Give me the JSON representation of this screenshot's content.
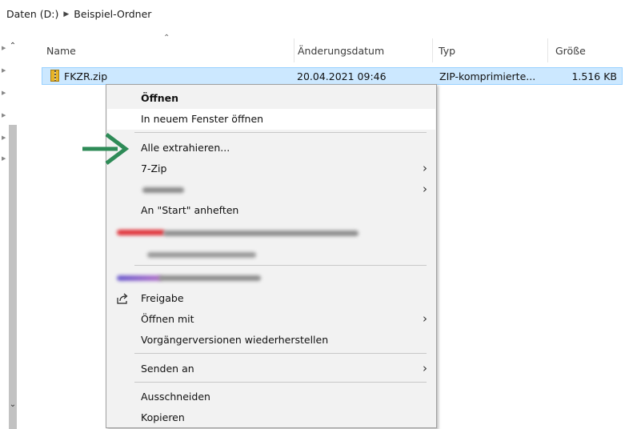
{
  "breadcrumb": {
    "items": [
      "Daten (D:)",
      "Beispiel-Ordner"
    ],
    "separator": "›"
  },
  "columns": {
    "name": "Name",
    "modified": "Änderungsdatum",
    "type": "Typ",
    "size": "Größe"
  },
  "file": {
    "name": "FKZR.zip",
    "modified": "20.04.2021 09:46",
    "type": "ZIP-komprimierte...",
    "size": "1.516 KB"
  },
  "context_menu": {
    "open": "Öffnen",
    "open_new_window": "In neuem Fenster öffnen",
    "extract_all": "Alle extrahieren...",
    "seven_zip": "7-Zip",
    "pin_start": "An \"Start\" anheften",
    "share": "Freigabe",
    "open_with": "Öffnen mit",
    "restore_previous": "Vorgängerversionen wiederherstellen",
    "send_to": "Senden an",
    "cut": "Ausschneiden",
    "copy": "Kopieren"
  },
  "colors": {
    "selection": "#cce8ff",
    "selection_border": "#99d1ff",
    "arrow": "#2e8b57",
    "menu_bg": "#f2f2f2"
  },
  "icons": [
    "zip-file-icon",
    "share-icon",
    "chevron-right-icon",
    "green-arrow-icon",
    "sort-up-icon"
  ]
}
